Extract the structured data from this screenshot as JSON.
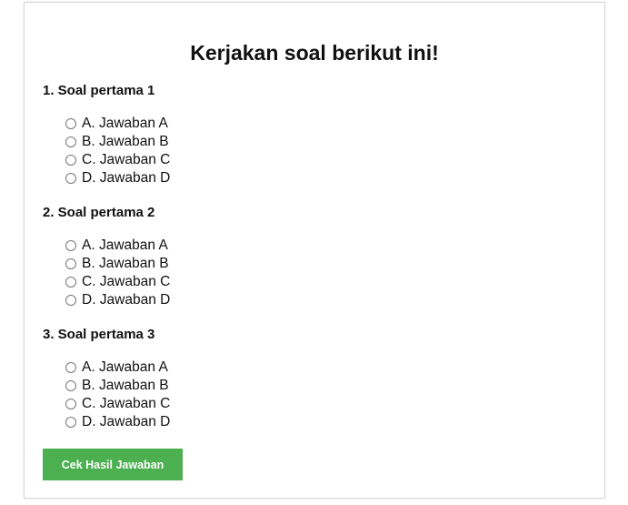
{
  "title": "Kerjakan soal berikut ini!",
  "questions": [
    {
      "label": "1. Soal pertama 1",
      "options": [
        "A. Jawaban A",
        "B. Jawaban B",
        "C. Jawaban C",
        "D. Jawaban D"
      ]
    },
    {
      "label": "2. Soal pertama 2",
      "options": [
        "A. Jawaban A",
        "B. Jawaban B",
        "C. Jawaban C",
        "D. Jawaban D"
      ]
    },
    {
      "label": "3. Soal pertama 3",
      "options": [
        "A. Jawaban A",
        "B. Jawaban B",
        "C. Jawaban C",
        "D. Jawaban D"
      ]
    }
  ],
  "submit_label": "Cek Hasil Jawaban",
  "colors": {
    "button": "#4caf50",
    "button_text": "#ffffff",
    "border": "#d6d6d6"
  }
}
